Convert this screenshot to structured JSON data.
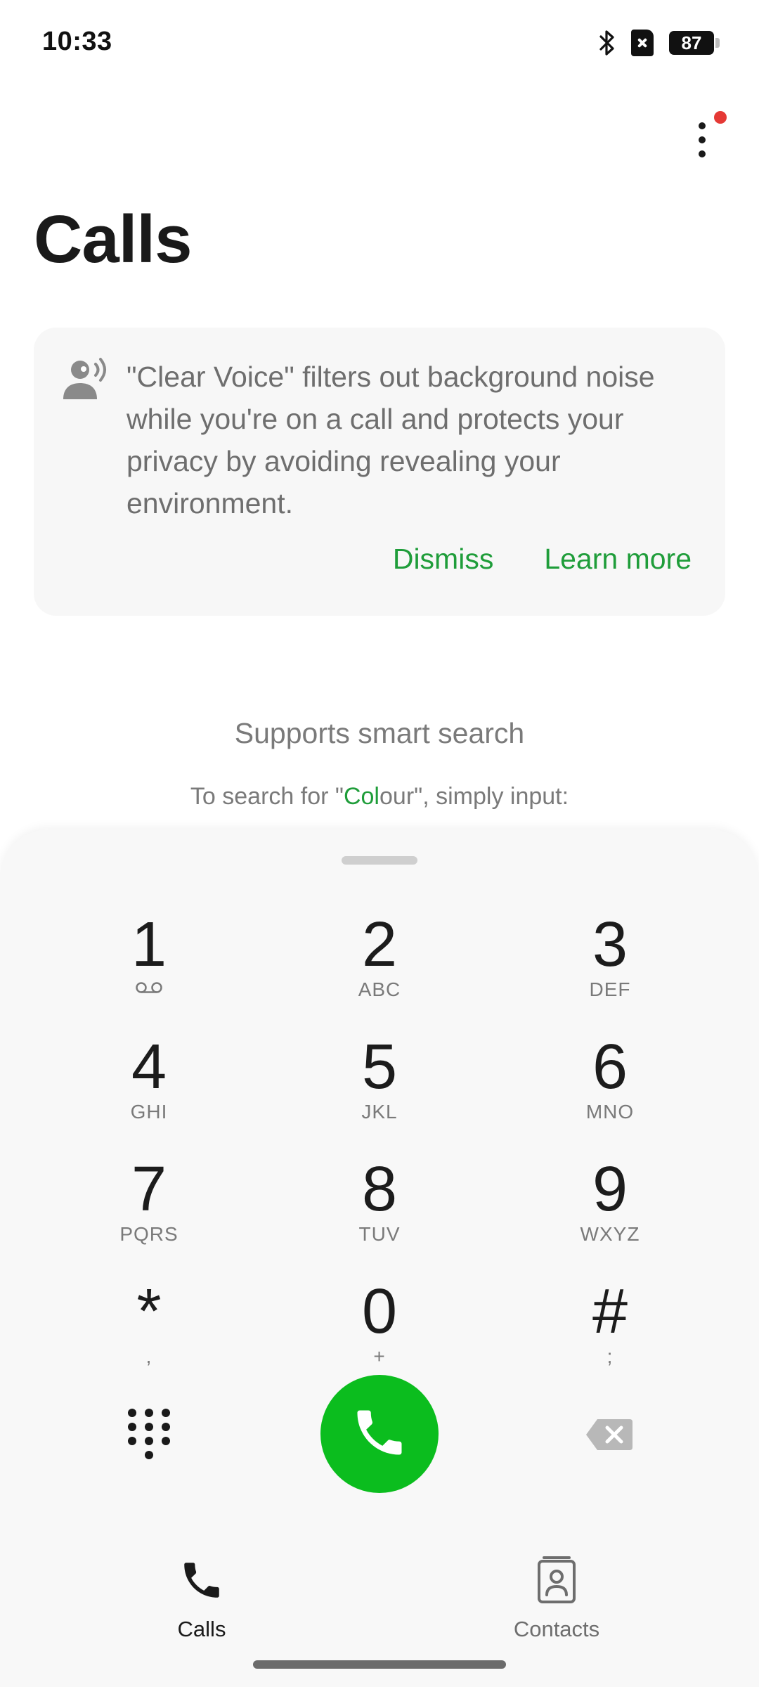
{
  "status_bar": {
    "time": "10:33",
    "battery": "87"
  },
  "header": {
    "title": "Calls"
  },
  "tip": {
    "text": "\"Clear Voice\" filters out background noise while you're on a call and protects your privacy by avoiding revealing your environment.",
    "dismiss_label": "Dismiss",
    "learn_more_label": "Learn more"
  },
  "smart_search": {
    "title": "Supports smart search",
    "hint_prefix": "To search for \"",
    "hint_highlight": "Col",
    "hint_rest": "our\"",
    "hint_suffix": ", simply input:"
  },
  "dialpad": {
    "keys": [
      {
        "digit": "1",
        "sub": ""
      },
      {
        "digit": "2",
        "sub": "ABC"
      },
      {
        "digit": "3",
        "sub": "DEF"
      },
      {
        "digit": "4",
        "sub": "GHI"
      },
      {
        "digit": "5",
        "sub": "JKL"
      },
      {
        "digit": "6",
        "sub": "MNO"
      },
      {
        "digit": "7",
        "sub": "PQRS"
      },
      {
        "digit": "8",
        "sub": "TUV"
      },
      {
        "digit": "9",
        "sub": "WXYZ"
      },
      {
        "digit": "*",
        "sub": ","
      },
      {
        "digit": "0",
        "sub": "+"
      },
      {
        "digit": "#",
        "sub": ";"
      }
    ]
  },
  "bottom_nav": {
    "items": [
      {
        "label": "Calls",
        "icon": "phone-icon",
        "active": true
      },
      {
        "label": "Contacts",
        "icon": "contact-card-icon",
        "active": false
      }
    ]
  },
  "colors": {
    "accent": "#1f9d3a",
    "call_button": "#0bbd1e",
    "badge": "#e53935"
  }
}
